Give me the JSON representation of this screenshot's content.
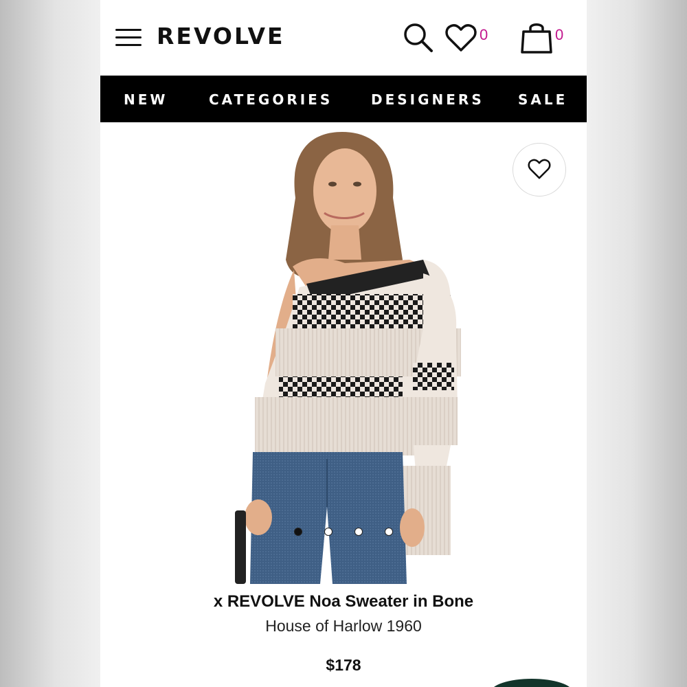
{
  "header": {
    "logo": "REVOLVE",
    "wishlist_count": "0",
    "bag_count": "0"
  },
  "nav": {
    "items": [
      "NEW",
      "CATEGORIES",
      "DESIGNERS",
      "SALE"
    ]
  },
  "product": {
    "title": "x REVOLVE Noa Sweater in Bone",
    "brand": "House of Harlow 1960",
    "price": "$178",
    "image_count": 4,
    "active_image": 1
  },
  "icons": {
    "menu": "hamburger-menu-icon",
    "search": "search-icon",
    "wishlist": "heart-icon",
    "bag": "shopping-bag-icon",
    "favorite": "heart-icon"
  },
  "colors": {
    "nav_bg": "#000000",
    "nav_text": "#ffffff",
    "badge": "#c2178e",
    "page_bg": "#ffffff"
  }
}
